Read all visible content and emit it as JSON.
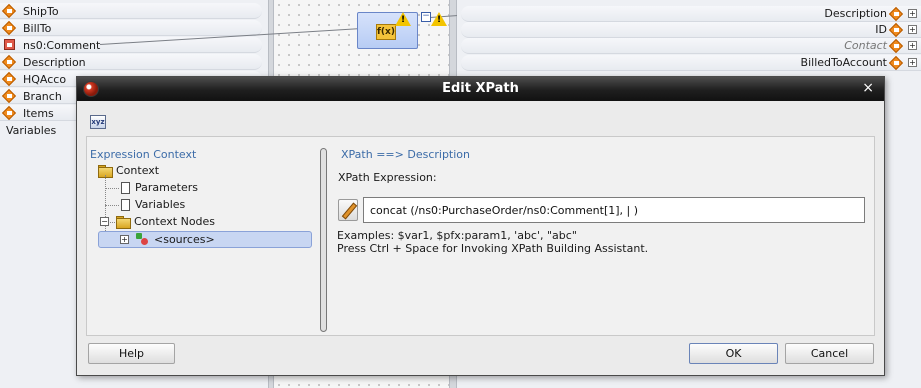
{
  "background": {
    "left_tree": [
      {
        "label": "ShipTo",
        "icon": "element-icon"
      },
      {
        "label": "BillTo",
        "icon": "element-icon"
      },
      {
        "label": "ns0:Comment",
        "icon": "error-element-icon"
      },
      {
        "label": "Description",
        "icon": "element-icon"
      },
      {
        "label": "HQAcco",
        "icon": "element-icon"
      },
      {
        "label": "Branch",
        "icon": "element-icon"
      },
      {
        "label": "Items",
        "icon": "element-icon"
      },
      {
        "label": "Variables",
        "icon": "none"
      }
    ],
    "right_tree": [
      {
        "label": "Description",
        "style": "normal"
      },
      {
        "label": "ID",
        "style": "normal"
      },
      {
        "label": "Contact",
        "style": "italic"
      },
      {
        "label": "BilledToAccount",
        "style": "normal"
      }
    ]
  },
  "dialog": {
    "title": "Edit XPath",
    "close_glyph": "×",
    "expression_context": {
      "heading": "Expression Context",
      "root": "Context",
      "children": [
        "Parameters",
        "Variables"
      ],
      "context_nodes": "Context Nodes",
      "sources": "<sources>"
    },
    "xpath": {
      "heading": "XPath ==> Description",
      "label": "XPath Expression:",
      "value": "concat (/ns0:PurchaseOrder/ns0:Comment[1], | )",
      "examples_line1": "Examples: $var1, $pfx:param1, 'abc', \"abc\"",
      "examples_line2": "Press Ctrl + Space for Invoking XPath Building Assistant."
    },
    "buttons": {
      "help": "Help",
      "ok": "OK",
      "cancel": "Cancel"
    }
  }
}
